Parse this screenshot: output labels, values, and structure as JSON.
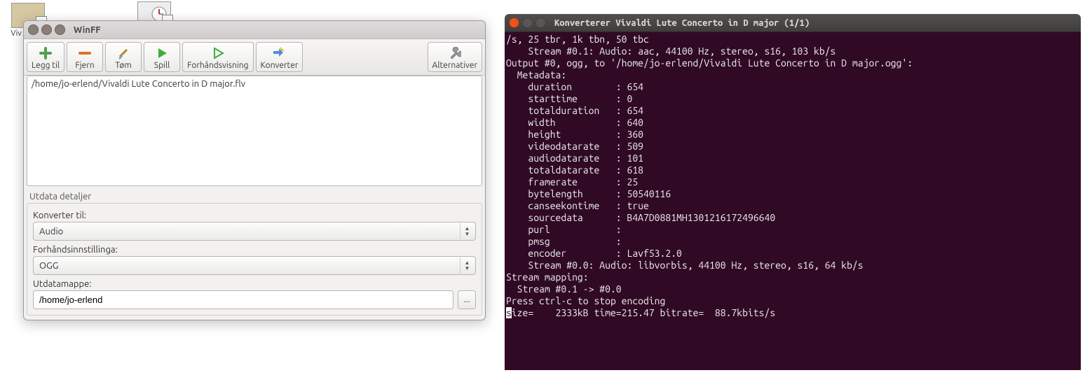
{
  "desktop": {
    "video_icon_label": "Viv\nCon\nm",
    "clock_icon_label": ""
  },
  "winff": {
    "title": "WinFF",
    "toolbar": {
      "add": "Legg til",
      "remove": "Fjern",
      "clear": "Tøm",
      "play": "Spill",
      "preview": "Forhåndsvisning",
      "convert": "Konverter",
      "options": "Alternativer"
    },
    "files": [
      "/home/jo-erlend/Vivaldi Lute Concerto in D major.flv"
    ],
    "details": {
      "section_label": "Utdata detaljer",
      "convert_to_label": "Konverter til:",
      "convert_to_value": "Audio",
      "preset_label": "Forhåndsinnstillinga:",
      "preset_value": "OGG",
      "outdir_label": "Utdatamappe:",
      "outdir_value": "/home/jo-erlend",
      "browse_glyph": "..."
    }
  },
  "terminal": {
    "title": "Konverterer Vivaldi Lute Concerto in D major (1/1)",
    "lines": [
      "/s, 25 tbr, 1k tbn, 50 tbc",
      "    Stream #0.1: Audio: aac, 44100 Hz, stereo, s16, 103 kb/s",
      "Output #0, ogg, to '/home/jo-erlend/Vivaldi Lute Concerto in D major.ogg':",
      "  Metadata:",
      "    duration        : 654",
      "    starttime       : 0",
      "    totalduration   : 654",
      "    width           : 640",
      "    height          : 360",
      "    videodatarate   : 509",
      "    audiodatarate   : 101",
      "    totaldatarate   : 618",
      "    framerate       : 25",
      "    bytelength      : 50540116",
      "    canseekontime   : true",
      "    sourcedata      : B4A7D0881MH1301216172496640",
      "    purl            : ",
      "    pmsg            : ",
      "    encoder         : Lavf53.2.0",
      "    Stream #0.0: Audio: libvorbis, 44100 Hz, stereo, s16, 64 kb/s",
      "Stream mapping:",
      "  Stream #0.1 -> #0.0",
      "Press ctrl-c to stop encoding"
    ],
    "status_prefix": "s",
    "status_rest": "ize=    2333kB time=215.47 bitrate=  88.7kbits/s"
  }
}
